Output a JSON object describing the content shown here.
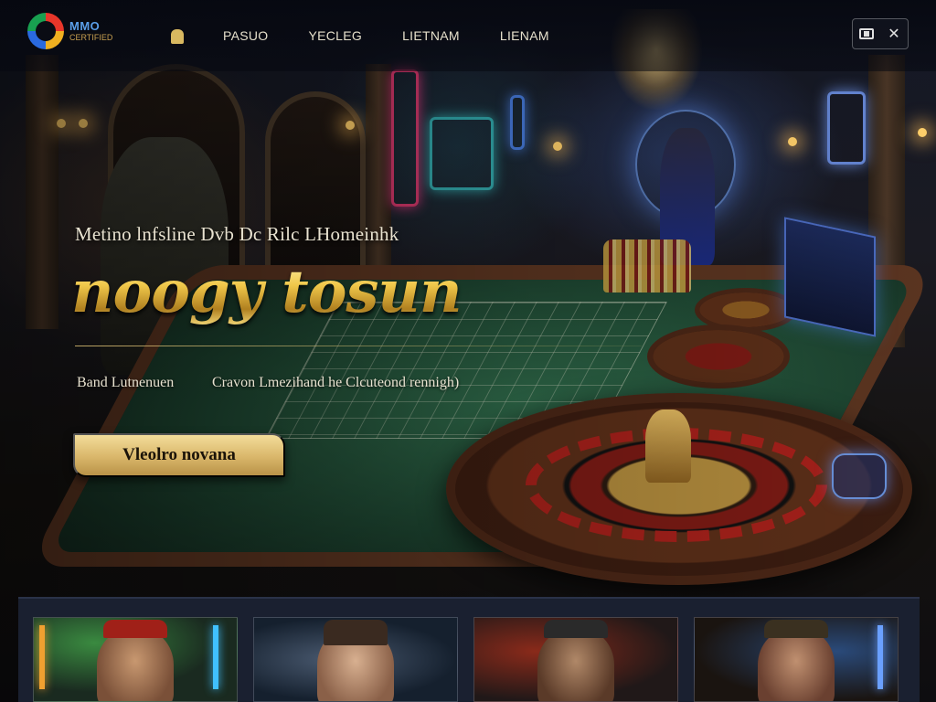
{
  "header": {
    "logo_line1": "MMO",
    "logo_line2": "CERTIFIED",
    "nav": [
      "PASUO",
      "YECLEG",
      "LIETNAM",
      "LIENAM"
    ]
  },
  "hero": {
    "subtitle": "Metino lnfsline Dvb Dc Rilc LHomeinhk",
    "title": "noogy tosun",
    "tag_left": "Band Lutnenuen",
    "tag_right": "Cravon Lmezihand he Clcuteond rennigh)",
    "cta_label": "Vleolro novana"
  },
  "cards": [
    {
      "name": "game-card-1",
      "icon": "warrior-portrait"
    },
    {
      "name": "game-card-2",
      "icon": "woman-portrait"
    },
    {
      "name": "game-card-3",
      "icon": "masked-warrior-portrait"
    },
    {
      "name": "game-card-4",
      "icon": "old-warrior-portrait"
    }
  ],
  "colors": {
    "accent_gold": "#d9b66a",
    "header_bg": "#060810",
    "strip_bg": "#1a2030"
  }
}
